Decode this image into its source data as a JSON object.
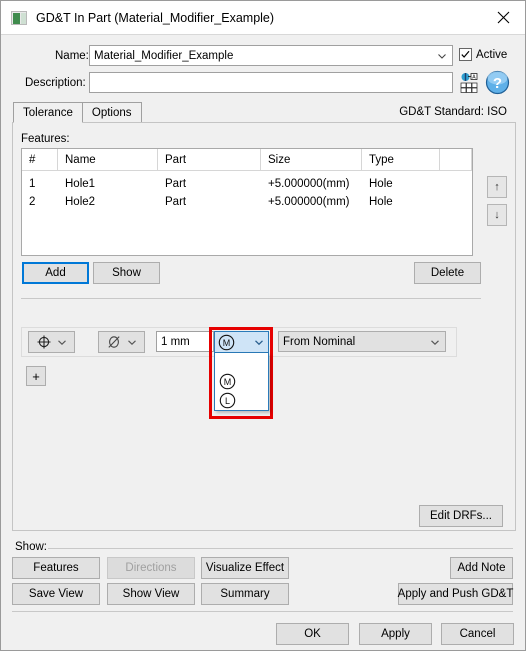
{
  "window": {
    "title": "GD&T In Part (Material_Modifier_Example)",
    "icon": "app-icon",
    "close_label": "close-icon"
  },
  "form": {
    "name_label": "Name:",
    "name_value": "Material_Modifier_Example",
    "description_label": "Description:",
    "description_value": "",
    "description_placeholder": "",
    "active_label": "Active",
    "active_checked": true,
    "tool_icons": [
      "matrix-icon",
      "help-icon"
    ]
  },
  "tabs": {
    "items": [
      {
        "label": "Tolerance",
        "active": true
      },
      {
        "label": "Options",
        "active": false
      }
    ],
    "standard_text": "GD&T Standard: ISO"
  },
  "features": {
    "section_label": "Features:",
    "columns": [
      "#",
      "Name",
      "Part",
      "Size",
      "Type",
      ""
    ],
    "rows": [
      [
        "1",
        "Hole1",
        "Part",
        "+5.000000(mm)",
        "Hole",
        ""
      ],
      [
        "2",
        "Hole2",
        "Part",
        "+5.000000(mm)",
        "Hole",
        ""
      ]
    ],
    "move_up_label": "↑",
    "move_down_label": "↓",
    "add_label": "Add",
    "show_label": "Show",
    "delete_label": "Delete"
  },
  "tolerance": {
    "symbol_button_label": "position-symbol",
    "diameter_button_label": "diameter-symbol",
    "value": "1 mm",
    "modifier_selected": "Ⓜ",
    "modifier_options": [
      "",
      "Ⓜ",
      "Ⓛ"
    ],
    "datum_reference": "From Nominal",
    "add_row_label": "+",
    "edit_drfs_label": "Edit DRFs..."
  },
  "show_section": {
    "label": "Show:",
    "buttons": [
      {
        "label": "Features",
        "enabled": true
      },
      {
        "label": "Directions",
        "enabled": false
      },
      {
        "label": "Visualize Effect",
        "enabled": true
      },
      {
        "label": "Add Note",
        "enabled": true
      },
      {
        "label": "Save View",
        "enabled": true
      },
      {
        "label": "Show View",
        "enabled": true
      },
      {
        "label": "Summary",
        "enabled": true
      },
      {
        "label": "Apply and Push GD&T",
        "enabled": true
      }
    ]
  },
  "footer": {
    "ok_label": "OK",
    "apply_label": "Apply",
    "cancel_label": "Cancel"
  },
  "colors": {
    "accent": "#0078d7",
    "highlight_box": "#e60000",
    "dropdown_select": "#cfe4f7"
  }
}
